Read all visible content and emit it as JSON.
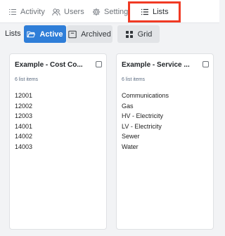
{
  "tabs": [
    {
      "label": "Activity",
      "icon": "activity-list-icon"
    },
    {
      "label": "Users",
      "icon": "users-icon"
    },
    {
      "label": "Settings",
      "icon": "gear-icon"
    },
    {
      "label": "Lists",
      "icon": "list-icon",
      "selected": true
    }
  ],
  "toolbar": {
    "lists_label": "Lists",
    "active_label": "Active",
    "archived_label": "Archived",
    "grid_label": "Grid",
    "active_color": "#2f7ed8"
  },
  "highlight_color": "#f03a24",
  "cards": [
    {
      "title": "Example - Cost Co...",
      "count": "6 list items",
      "items": [
        "12001",
        "12002",
        "12003",
        "14001",
        "14002",
        "14003"
      ]
    },
    {
      "title": "Example - Service ...",
      "count": "6 list items",
      "items": [
        "Communications",
        "Gas",
        "HV - Electricity",
        "LV - Electricity",
        "Sewer",
        "Water"
      ]
    }
  ]
}
